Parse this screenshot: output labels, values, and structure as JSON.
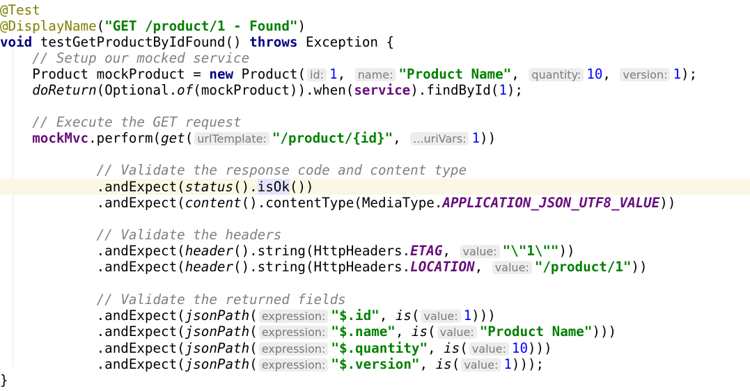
{
  "code": {
    "annotation_test": "@Test",
    "annotation_display": "@DisplayName",
    "display_name_str": "\"GET /product/1 - Found\"",
    "kw_void": "void",
    "method_name": "testGetProductByIdFound",
    "kw_throws": "throws",
    "exception_type": "Exception",
    "comment_setup": "// Setup our mocked service",
    "product_type": "Product",
    "mock_product_var": "mockProduct",
    "kw_new": "new",
    "hint_id": "id:",
    "val_id": "1",
    "hint_name": "name:",
    "val_name": "\"Product Name\"",
    "hint_quantity": "quantity:",
    "val_quantity": "10",
    "hint_version": "version:",
    "val_version": "1",
    "do_return": "doReturn",
    "optional": "Optional.",
    "of": "of",
    "service_field": "service",
    "find_by_id": ".findById(",
    "find_by_id_arg": "1",
    "comment_execute": "// Execute the GET request",
    "mockmvc_field": "mockMvc",
    "perform": ".perform(",
    "get": "get",
    "hint_url_template": "urlTemplate:",
    "url_template_str": "\"/product/{id}\"",
    "hint_uri_vars": "...uriVars:",
    "uri_vars_val": "1",
    "comment_validate_response": "// Validate the response code and content type",
    "and_expect": ".andExpect(",
    "status": "status",
    "is_ok": "isOk",
    "content": "content",
    "content_type": ".contentType(MediaType.",
    "media_type_const": "APPLICATION_JSON_UTF8_VALUE",
    "comment_validate_headers": "// Validate the headers",
    "header": "header",
    "string_headers": ".string(HttpHeaders.",
    "etag_const": "ETAG",
    "hint_value": "value:",
    "etag_str": "\"\\\"1\\\"\"",
    "location_const": "LOCATION",
    "location_str": "\"/product/1\"",
    "comment_validate_fields": "// Validate the returned fields",
    "json_path": "jsonPath",
    "hint_expression": "expression:",
    "path_id": "\"$.id\"",
    "is": "is",
    "val_json_id": "1",
    "path_name": "\"$.name\"",
    "val_json_name": "\"Product Name\"",
    "path_quantity": "\"$.quantity\"",
    "val_json_quantity": "10",
    "path_version": "\"$.version\"",
    "val_json_version": "1",
    "closing_brace": "}"
  }
}
